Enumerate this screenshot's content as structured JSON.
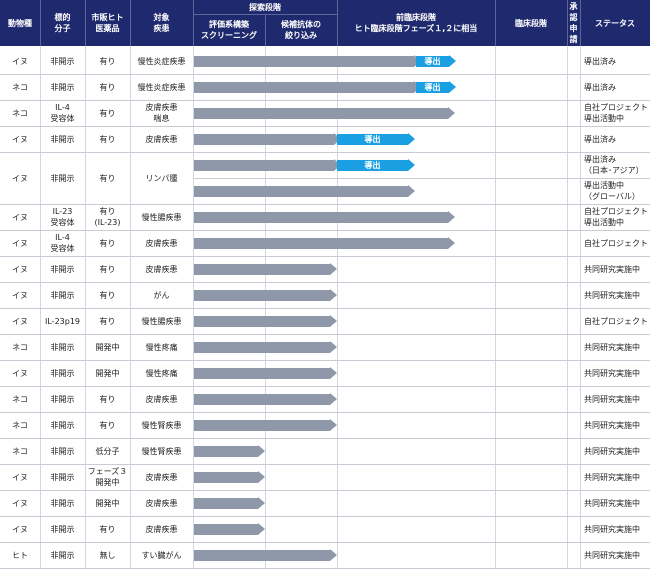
{
  "headers": {
    "species": "動物種",
    "target": "標的\n分子",
    "marketed": "市販ヒト\n医薬品",
    "disease": "対象\n疾患",
    "exploration": "探索段階",
    "screening": "評価系構築\nスクリーニング",
    "narrowing": "候補抗体の\n絞り込み",
    "preclinical": "前臨床段階\nヒト臨床段階フェーズ１,２に相当",
    "clinical": "臨床段階",
    "approval": "承\n認\n申\n請",
    "status": "ステータス"
  },
  "out_label": "導出",
  "rows": [
    {
      "species": "イヌ",
      "target": "非開示",
      "marketed": "有り",
      "disease": "慢性炎症疾患",
      "progress": "preclinical",
      "outlicensed": "preclinical",
      "status": "導出済み"
    },
    {
      "species": "ネコ",
      "target": "非開示",
      "marketed": "有り",
      "disease": "慢性炎症疾患",
      "progress": "preclinical",
      "outlicensed": "preclinical",
      "status": "導出済み"
    },
    {
      "species": "ネコ",
      "target": "IL-4\n受容体",
      "marketed": "有り",
      "disease": "皮膚疾患\n喘息",
      "progress": "preclinical",
      "outlicensed": "",
      "status": "自社プロジェクト\n導出活動中"
    },
    {
      "species": "イヌ",
      "target": "非開示",
      "marketed": "有り",
      "disease": "皮膚疾患",
      "progress": "preclinical",
      "outlicensed": "narrowing",
      "status": "導出済み"
    },
    {
      "species": "イヌ",
      "target": "非開示",
      "marketed": "有り",
      "disease": "リンパ腫",
      "progress": "preclinical",
      "outlicensed": "narrowing",
      "status": "導出済み\n（日本･アジア）",
      "progress2": "preclinical",
      "status2": "導出活動中\n（グローバル）"
    },
    {
      "species": "イヌ",
      "target": "IL-23\n受容体",
      "marketed": "有り\n(IL-23)",
      "disease": "慢性腸疾患",
      "progress": "preclinical",
      "outlicensed": "",
      "status": "自社プロジェクト\n導出活動中"
    },
    {
      "species": "イヌ",
      "target": "IL-4\n受容体",
      "marketed": "有り",
      "disease": "皮膚疾患",
      "progress": "preclinical",
      "outlicensed": "",
      "status": "自社プロジェクト"
    },
    {
      "species": "イヌ",
      "target": "非開示",
      "marketed": "有り",
      "disease": "皮膚疾患",
      "progress": "narrowing",
      "outlicensed": "",
      "status": "共同研究実施中"
    },
    {
      "species": "イヌ",
      "target": "非開示",
      "marketed": "有り",
      "disease": "がん",
      "progress": "narrowing",
      "outlicensed": "",
      "status": "共同研究実施中"
    },
    {
      "species": "イヌ",
      "target": "IL-23p19",
      "marketed": "有り",
      "disease": "慢性腸疾患",
      "progress": "narrowing",
      "outlicensed": "",
      "status": "自社プロジェクト"
    },
    {
      "species": "ネコ",
      "target": "非開示",
      "marketed": "開発中",
      "disease": "慢性疼痛",
      "progress": "narrowing",
      "outlicensed": "",
      "status": "共同研究実施中"
    },
    {
      "species": "イヌ",
      "target": "非開示",
      "marketed": "開発中",
      "disease": "慢性疼痛",
      "progress": "narrowing",
      "outlicensed": "",
      "status": "共同研究実施中"
    },
    {
      "species": "ネコ",
      "target": "非開示",
      "marketed": "有り",
      "disease": "皮膚疾患",
      "progress": "narrowing",
      "outlicensed": "",
      "status": "共同研究実施中"
    },
    {
      "species": "ネコ",
      "target": "非開示",
      "marketed": "有り",
      "disease": "慢性腎疾患",
      "progress": "narrowing",
      "outlicensed": "",
      "status": "共同研究実施中"
    },
    {
      "species": "ネコ",
      "target": "非開示",
      "marketed": "低分子",
      "disease": "慢性腎疾患",
      "progress": "screening",
      "outlicensed": "",
      "status": "共同研究実施中"
    },
    {
      "species": "イヌ",
      "target": "非開示",
      "marketed": "フェーズ３\n開発中",
      "disease": "皮膚疾患",
      "progress": "screening",
      "outlicensed": "",
      "status": "共同研究実施中"
    },
    {
      "species": "イヌ",
      "target": "非開示",
      "marketed": "開発中",
      "disease": "皮膚疾患",
      "progress": "screening",
      "outlicensed": "",
      "status": "共同研究実施中"
    },
    {
      "species": "イヌ",
      "target": "非開示",
      "marketed": "有り",
      "disease": "皮膚疾患",
      "progress": "screening",
      "outlicensed": "",
      "status": "共同研究実施中"
    },
    {
      "species": "ヒト",
      "target": "非開示",
      "marketed": "無し",
      "disease": "すい臓がん",
      "progress": "narrowing",
      "outlicensed": "",
      "status": "共同研究実施中"
    }
  ]
}
